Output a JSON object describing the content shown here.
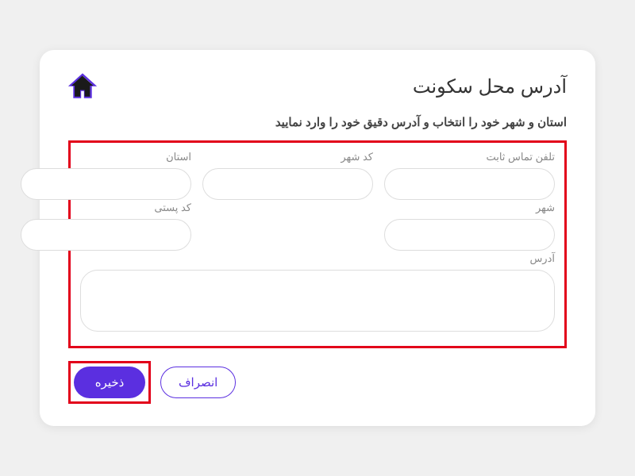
{
  "header": {
    "title": "آدرس محل سکونت"
  },
  "subtitle": "استان و شهر خود را انتخاب و آدرس دقیق خود را وارد نمایید",
  "fields": {
    "phone": {
      "label": "تلفن تماس ثابت",
      "value": ""
    },
    "cityCode": {
      "label": "کد شهر",
      "value": ""
    },
    "province": {
      "label": "استان",
      "value": ""
    },
    "city": {
      "label": "شهر",
      "value": ""
    },
    "postal": {
      "label": "کد پستی",
      "value": ""
    },
    "address": {
      "label": "آدرس",
      "value": ""
    }
  },
  "actions": {
    "save": "ذخیره",
    "cancel": "انصراف"
  }
}
